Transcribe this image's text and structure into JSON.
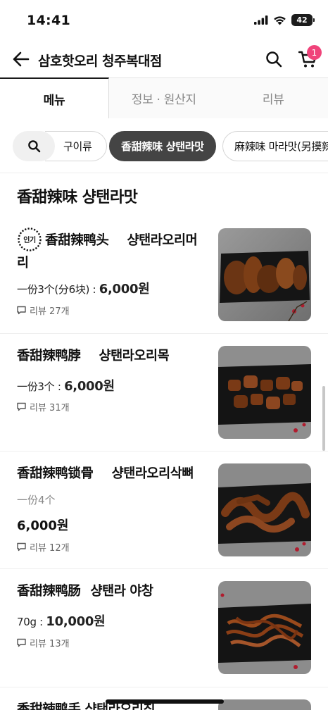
{
  "status_bar": {
    "time": "14:41",
    "battery": "42"
  },
  "header": {
    "title": "삼호핫오리 청주복대점",
    "cart_count": "1"
  },
  "tabs": [
    {
      "label": "메뉴",
      "active": true
    },
    {
      "label": "정보 · 원산지",
      "active": false
    },
    {
      "label": "리뷰",
      "active": false
    }
  ],
  "categories": [
    {
      "label": "구이류",
      "active": false
    },
    {
      "label": "香甜辣味 샹탠라맛",
      "active": true
    },
    {
      "label": "麻辣味 마라맛(另摸辣)",
      "active": false
    }
  ],
  "section": {
    "title": "香甜辣味 샹탠라맛"
  },
  "items": [
    {
      "badge": "인기",
      "name_cn": "香甜辣鸭头",
      "name_kr": "샹탠라오리머리",
      "serving": "一份3个(分6块)",
      "price": "6,000원",
      "reviews": "리뷰 27개"
    },
    {
      "name_cn": "香甜辣鸭脖",
      "name_kr": "샹탠라오리목",
      "serving": "一份3个",
      "price": "6,000원",
      "reviews": "리뷰 31개"
    },
    {
      "name_cn": "香甜辣鸭锁骨",
      "name_kr": "샹탠라오리삭뼈",
      "serving": "一份4个",
      "price": "6,000원",
      "reviews": "리뷰 12개"
    },
    {
      "name_cn": "香甜辣鸭肠",
      "name_kr": "샹탠라 야창",
      "serving": "70g",
      "price": "10,000원",
      "reviews": "리뷰 13개"
    },
    {
      "name_partial": "香甜辣鸭手 샹탠라오리칭"
    }
  ],
  "colors": {
    "accent_badge": "#f0437a",
    "chip_active": "#444444",
    "text_primary": "#111111",
    "text_secondary": "#888888"
  },
  "icons": {
    "back": "arrow-left-icon",
    "search": "search-icon",
    "cart": "cart-icon",
    "review": "speech-bubble-icon",
    "popular": "popular-badge-icon"
  }
}
